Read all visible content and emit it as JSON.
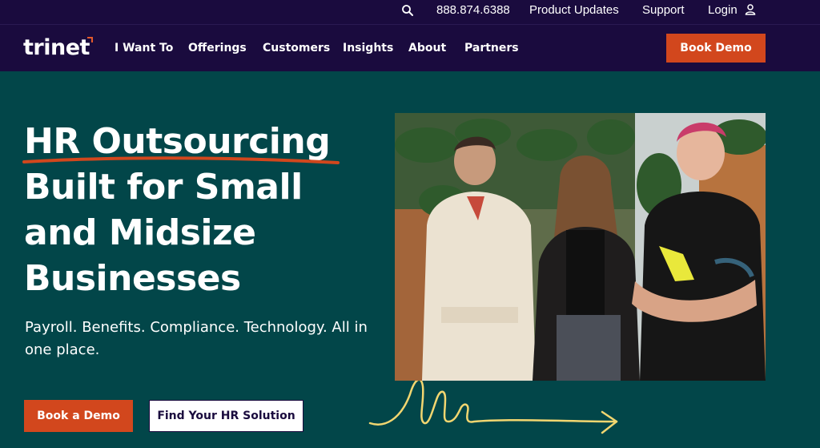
{
  "utility": {
    "phone": "888.874.6388",
    "product_updates": "Product Updates",
    "support": "Support",
    "login": "Login"
  },
  "nav": {
    "logo": "trinet",
    "items": [
      "I Want To",
      "Offerings",
      "Customers",
      "Insights",
      "About",
      "Partners"
    ],
    "book_demo": "Book Demo"
  },
  "hero": {
    "title_lines": [
      "HR Outsourcing",
      "Built for Small",
      "and Midsize",
      "Businesses"
    ],
    "subtitle": "Payroll. Benefits. Compliance. Technology. All in one place.",
    "primary_cta": "Book a Demo",
    "secondary_cta": "Find Your HR Solution"
  },
  "colors": {
    "nav_bg": "#1a0b3e",
    "hero_bg": "#024649",
    "accent_orange": "#d2471d",
    "squiggle_yellow": "#f2d670"
  },
  "icons": {
    "search": "search-icon",
    "user": "user-icon",
    "arrow": "arrow-right-icon"
  }
}
